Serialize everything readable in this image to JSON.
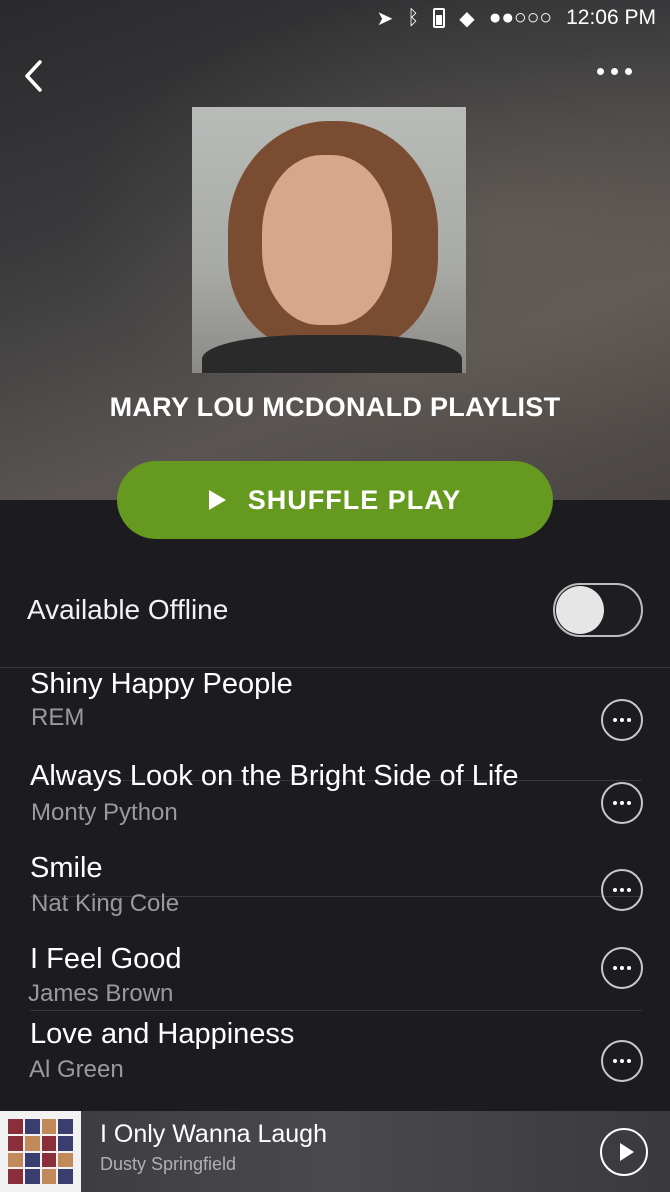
{
  "status_bar": {
    "signal": "●●○○○",
    "time": "12:06 PM",
    "icons": [
      "location-arrow-icon",
      "bluetooth-icon",
      "battery-icon",
      "wifi-icon"
    ]
  },
  "header": {
    "back_icon": "chevron-left-icon",
    "more_icon": "ellipsis-icon"
  },
  "playlist": {
    "title": "MARY LOU MCDONALD PLAYLIST",
    "shuffle_label": "SHUFFLE PLAY",
    "shuffle_color": "#65991f"
  },
  "offline": {
    "label": "Available Offline",
    "enabled": false
  },
  "tracks": [
    {
      "title": "Shiny Happy People",
      "artist": "REM"
    },
    {
      "title": "Always Look on the Bright Side of Life",
      "artist": "Monty Python"
    },
    {
      "title": "Smile",
      "artist": "Nat King Cole"
    },
    {
      "title": "I Feel Good",
      "artist": "James Brown"
    },
    {
      "title": "Love and Happiness",
      "artist": "Al Green"
    }
  ],
  "now_playing": {
    "title": "I Only Wanna Laugh",
    "artist": "Dusty Springfield",
    "play_icon": "play-circle-icon"
  }
}
